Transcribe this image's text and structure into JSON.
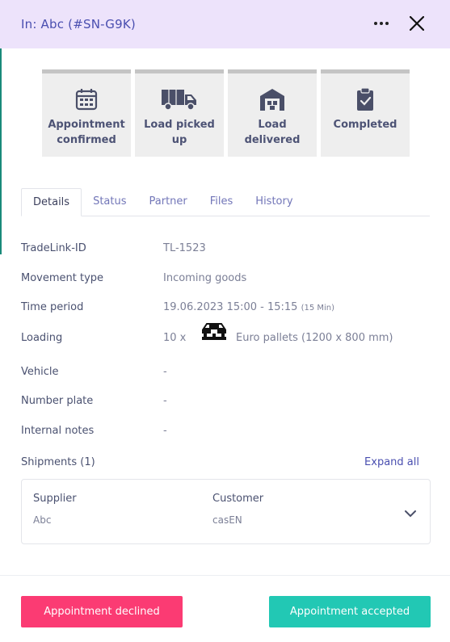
{
  "header": {
    "title": "In: Abc (#SN-G9K)",
    "background": "#ede3fb"
  },
  "steps": [
    {
      "label": "Appointment confirmed",
      "icon": "calendar-icon"
    },
    {
      "label": "Load picked up",
      "icon": "truck-icon"
    },
    {
      "label": "Load delivered",
      "icon": "warehouse-icon"
    },
    {
      "label": "Completed",
      "icon": "clipboard-check-icon"
    }
  ],
  "tabs": [
    {
      "label": "Details",
      "active": true
    },
    {
      "label": "Status",
      "active": false
    },
    {
      "label": "Partner",
      "active": false
    },
    {
      "label": "Files",
      "active": false
    },
    {
      "label": "History",
      "active": false
    }
  ],
  "details": {
    "tradelink_id": {
      "label": "TradeLink-ID",
      "value": "TL-1523"
    },
    "movement_type": {
      "label": "Movement type",
      "value": "Incoming goods"
    },
    "time_period": {
      "label": "Time period",
      "value": "19.06.2023 15:00 - 15:15",
      "duration": "(15 Min)"
    },
    "loading": {
      "label": "Loading",
      "quantity": "10 x",
      "item": "Euro pallets (1200 x 800 mm)",
      "icon": "pallet-icon"
    },
    "vehicle": {
      "label": "Vehicle",
      "value": "-"
    },
    "number_plate": {
      "label": "Number plate",
      "value": "-"
    },
    "internal_notes": {
      "label": "Internal notes",
      "value": "-"
    }
  },
  "shipments": {
    "title": "Shipments (1)",
    "expand_all": "Expand all",
    "items": [
      {
        "supplier_label": "Supplier",
        "supplier": "Abc",
        "customer_label": "Customer",
        "customer": "casEN"
      }
    ]
  },
  "actions": {
    "decline_label": "Appointment declined",
    "accept_label": "Appointment accepted",
    "decline_color": "#fb3b73",
    "accept_color": "#22c8b4"
  }
}
